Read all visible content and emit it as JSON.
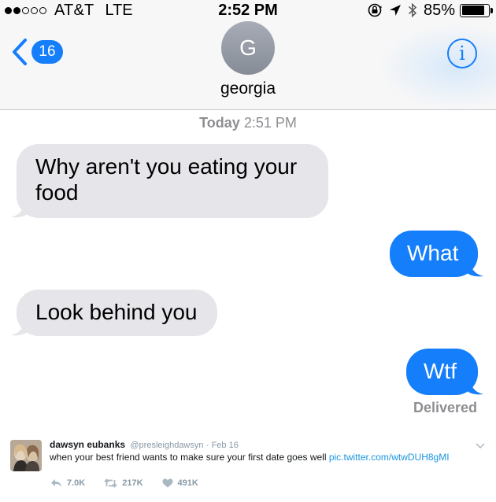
{
  "status_bar": {
    "carrier": "AT&T",
    "network": "LTE",
    "time": "2:52 PM",
    "battery": "85%",
    "battery_level": 0.85,
    "signal_bars": 2,
    "icons": [
      "rotation-lock-icon",
      "location-arrow-icon",
      "bluetooth-icon",
      "battery-icon"
    ]
  },
  "nav": {
    "back_count": "16",
    "contact_initial": "G",
    "contact_name": "georgia",
    "info_label": "i"
  },
  "conversation": {
    "timestamp_day": "Today",
    "timestamp_time": "2:51 PM",
    "messages": [
      {
        "direction": "incoming",
        "text": "Why aren't you eating your food"
      },
      {
        "direction": "outgoing",
        "text": "What"
      },
      {
        "direction": "incoming",
        "text": "Look behind you"
      },
      {
        "direction": "outgoing",
        "text": "Wtf"
      }
    ],
    "delivery_status": "Delivered"
  },
  "tweet": {
    "author_name": "dawsyn eubanks",
    "author_handle": "@presleighdawsyn",
    "date": "· Feb 16",
    "text": "when your best friend wants to make sure your first date goes well ",
    "link": "pic.twitter.com/wtwDUH8gMI",
    "replies": "7.0K",
    "retweets": "217K",
    "likes": "491K"
  },
  "colors": {
    "imessage_blue": "#157efb",
    "incoming_bubble": "#e5e5ea",
    "twitter_link": "#1b95e0",
    "meta_gray": "#8e8e93"
  }
}
